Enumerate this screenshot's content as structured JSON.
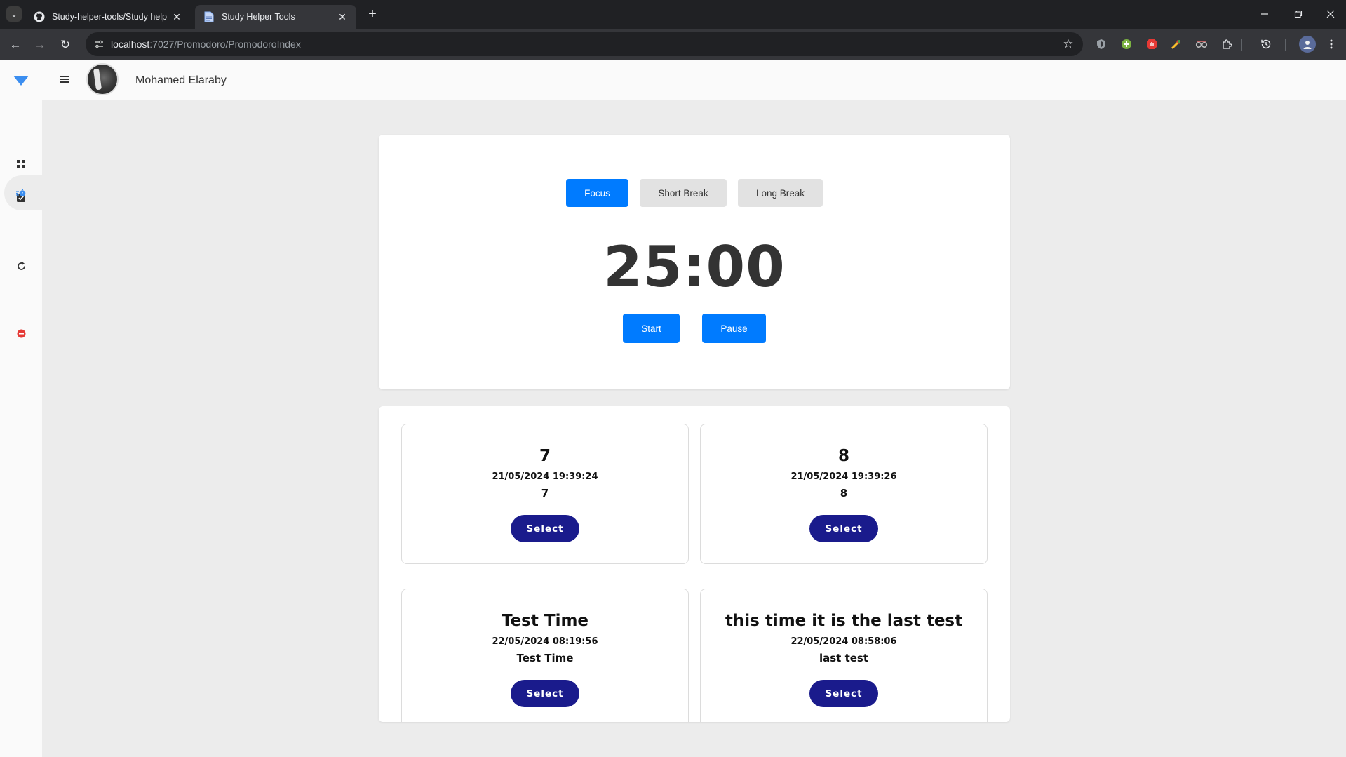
{
  "browser": {
    "tabs": [
      {
        "title": "Study-helper-tools/Study helper",
        "favicon": "github-icon",
        "active": false
      },
      {
        "title": "Study Helper Tools",
        "favicon": "document-icon",
        "active": true
      }
    ],
    "url_host": "localhost",
    "url_path": ":7027/Promodoro/PromodoroIndex"
  },
  "app": {
    "username": "Mohamed Elaraby",
    "sidebar_icons": [
      "dashboard-icon",
      "checkbox-icon",
      "timer-icon",
      "refresh-icon",
      "logout-icon"
    ],
    "accent_color": "#007bff",
    "select_color": "#1a1b8c"
  },
  "timer": {
    "modes": [
      "Focus",
      "Short Break",
      "Long Break"
    ],
    "active_mode": "Focus",
    "time": "25:00",
    "start_label": "Start",
    "pause_label": "Pause"
  },
  "sessions": [
    {
      "title": "7",
      "date": "21/05/2024 19:39:24",
      "description": "7",
      "button": "Select"
    },
    {
      "title": "8",
      "date": "21/05/2024 19:39:26",
      "description": "8",
      "button": "Select"
    },
    {
      "title": "Test Time",
      "date": "22/05/2024 08:19:56",
      "description": "Test Time",
      "button": "Select"
    },
    {
      "title": "this time it is the last test",
      "date": "22/05/2024 08:58:06",
      "description": "last test",
      "button": "Select"
    }
  ]
}
